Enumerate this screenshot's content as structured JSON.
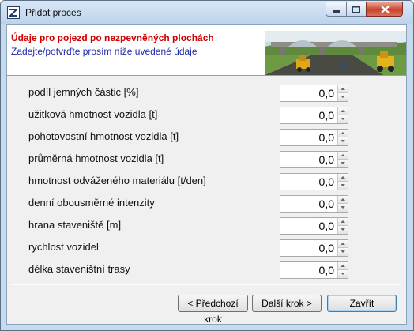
{
  "window": {
    "title": "Přidat proces",
    "controls": {
      "minimize_icon": "minimize-icon",
      "maximize_icon": "maximize-icon",
      "close_icon": "close-icon"
    }
  },
  "header": {
    "title": "Údaje pro pojezd po nezpevněných plochách",
    "subtitle": "Zadejte/potvrďte prosím níže uvedené údaje",
    "image": "construction-site-banner"
  },
  "fields": [
    {
      "label": "podíl jemných částic [%]",
      "value": "0,0"
    },
    {
      "label": "užitková hmotnost vozidla [t]",
      "value": "0,0"
    },
    {
      "label": "pohotovostní hmotnost vozidla [t]",
      "value": "0,0"
    },
    {
      "label": "průměrná hmotnost vozidla [t]",
      "value": "0,0"
    },
    {
      "label": "hmotnost odváženého materiálu [t/den]",
      "value": "0,0"
    },
    {
      "label": "denní obousměrné intenzity",
      "value": "0,0"
    },
    {
      "label": "hrana staveniště [m]",
      "value": "0,0"
    },
    {
      "label": "rychlost vozidel",
      "value": "0,0"
    },
    {
      "label": "délka staveništní trasy",
      "value": "0,0"
    }
  ],
  "buttons": {
    "prev": "< Předchozí krok",
    "next": "Další krok >",
    "close": "Zavřít"
  }
}
